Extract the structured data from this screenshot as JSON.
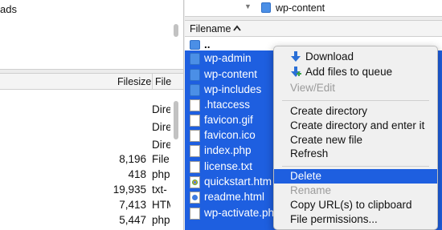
{
  "left_pane": {
    "tree": {
      "partial_item": "ads"
    },
    "columns": {
      "filesize": "Filesize",
      "filetype": "File"
    },
    "rows": [
      {
        "size": "",
        "type": "Dire"
      },
      {
        "size": "",
        "type": "Dire"
      },
      {
        "size": "",
        "type": "Dire"
      },
      {
        "size": "8,196",
        "type": "File"
      },
      {
        "size": "418",
        "type": "php"
      },
      {
        "size": "19,935",
        "type": "txt-"
      },
      {
        "size": "7,413",
        "type": "HTM"
      },
      {
        "size": "5,447",
        "type": "php"
      }
    ]
  },
  "right_pane": {
    "tree": {
      "current_folder": "wp-content"
    },
    "columns": {
      "filename": "Filename",
      "sort_icon": "chevron-up-icon"
    },
    "parent_entry": "..",
    "files": [
      {
        "name": "wp-admin",
        "icon": "folder-icon"
      },
      {
        "name": "wp-content",
        "icon": "folder-icon"
      },
      {
        "name": "wp-includes",
        "icon": "folder-icon"
      },
      {
        "name": ".htaccess",
        "icon": "file-icon"
      },
      {
        "name": "favicon.gif",
        "icon": "file-icon"
      },
      {
        "name": "favicon.ico",
        "icon": "file-icon"
      },
      {
        "name": "index.php",
        "icon": "file-icon"
      },
      {
        "name": "license.txt",
        "icon": "file-icon"
      },
      {
        "name": "quickstart.htm",
        "icon": "chrome-file-icon"
      },
      {
        "name": "readme.html",
        "icon": "html-file-icon"
      },
      {
        "name": "wp-activate.php",
        "icon": "file-icon"
      }
    ]
  },
  "context_menu": {
    "download": "Download",
    "add_to_queue": "Add files to queue",
    "view_edit": "View/Edit",
    "create_directory": "Create directory",
    "create_directory_enter": "Create directory and enter it",
    "create_new_file": "Create new file",
    "refresh": "Refresh",
    "delete": "Delete",
    "rename": "Rename",
    "copy_urls": "Copy URL(s) to clipboard",
    "file_permissions": "File permissions..."
  },
  "colors": {
    "selection": "#1e5fe0",
    "folder": "#4b8fe6",
    "disabled_text": "#9b9b9b"
  }
}
